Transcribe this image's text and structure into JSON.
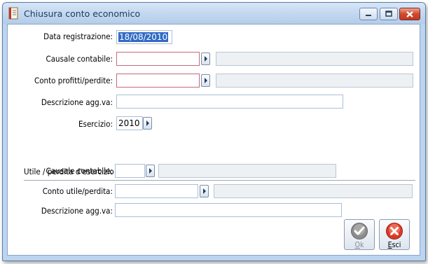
{
  "window": {
    "title": "Chiusura conto economico"
  },
  "form": {
    "data_registrazione": {
      "label": "Data registrazione:",
      "value": "18/08/2010"
    },
    "causale_contabile": {
      "label": "Causale contabile:",
      "value": "",
      "description": ""
    },
    "conto_profitti": {
      "label": "Conto profitti/perdite:",
      "value": "",
      "description": ""
    },
    "descrizione_agg": {
      "label": "Descrizione agg.va:",
      "value": ""
    },
    "esercizio": {
      "label": "Esercizio:",
      "value": "2010"
    }
  },
  "section": {
    "title": "Utile / perdita d'esercizio",
    "causale_contabile": {
      "label": "Causale contabile:",
      "value": "",
      "description": ""
    },
    "conto_utile": {
      "label": "Conto utile/perdita:",
      "value": "",
      "description": ""
    },
    "descrizione_agg": {
      "label": "Descrizione agg.va:",
      "value": ""
    }
  },
  "buttons": {
    "ok": {
      "label": "Ok",
      "accel": "O",
      "rest": "k",
      "enabled": false
    },
    "esci": {
      "label": "Esci",
      "accel": "E",
      "rest": "sci",
      "enabled": true
    }
  },
  "colors": {
    "window_frame": "#bcd4ee",
    "required_border": "#c76a7c",
    "selection": "#316ac5",
    "close_button": "#c03b22"
  },
  "icons": {
    "app": "document-icon",
    "minimize": "minimize-icon",
    "maximize": "maximize-icon",
    "close": "close-icon",
    "zoom": "chevron-right-icon",
    "ok": "checkmark-icon",
    "esci": "cancel-icon"
  }
}
